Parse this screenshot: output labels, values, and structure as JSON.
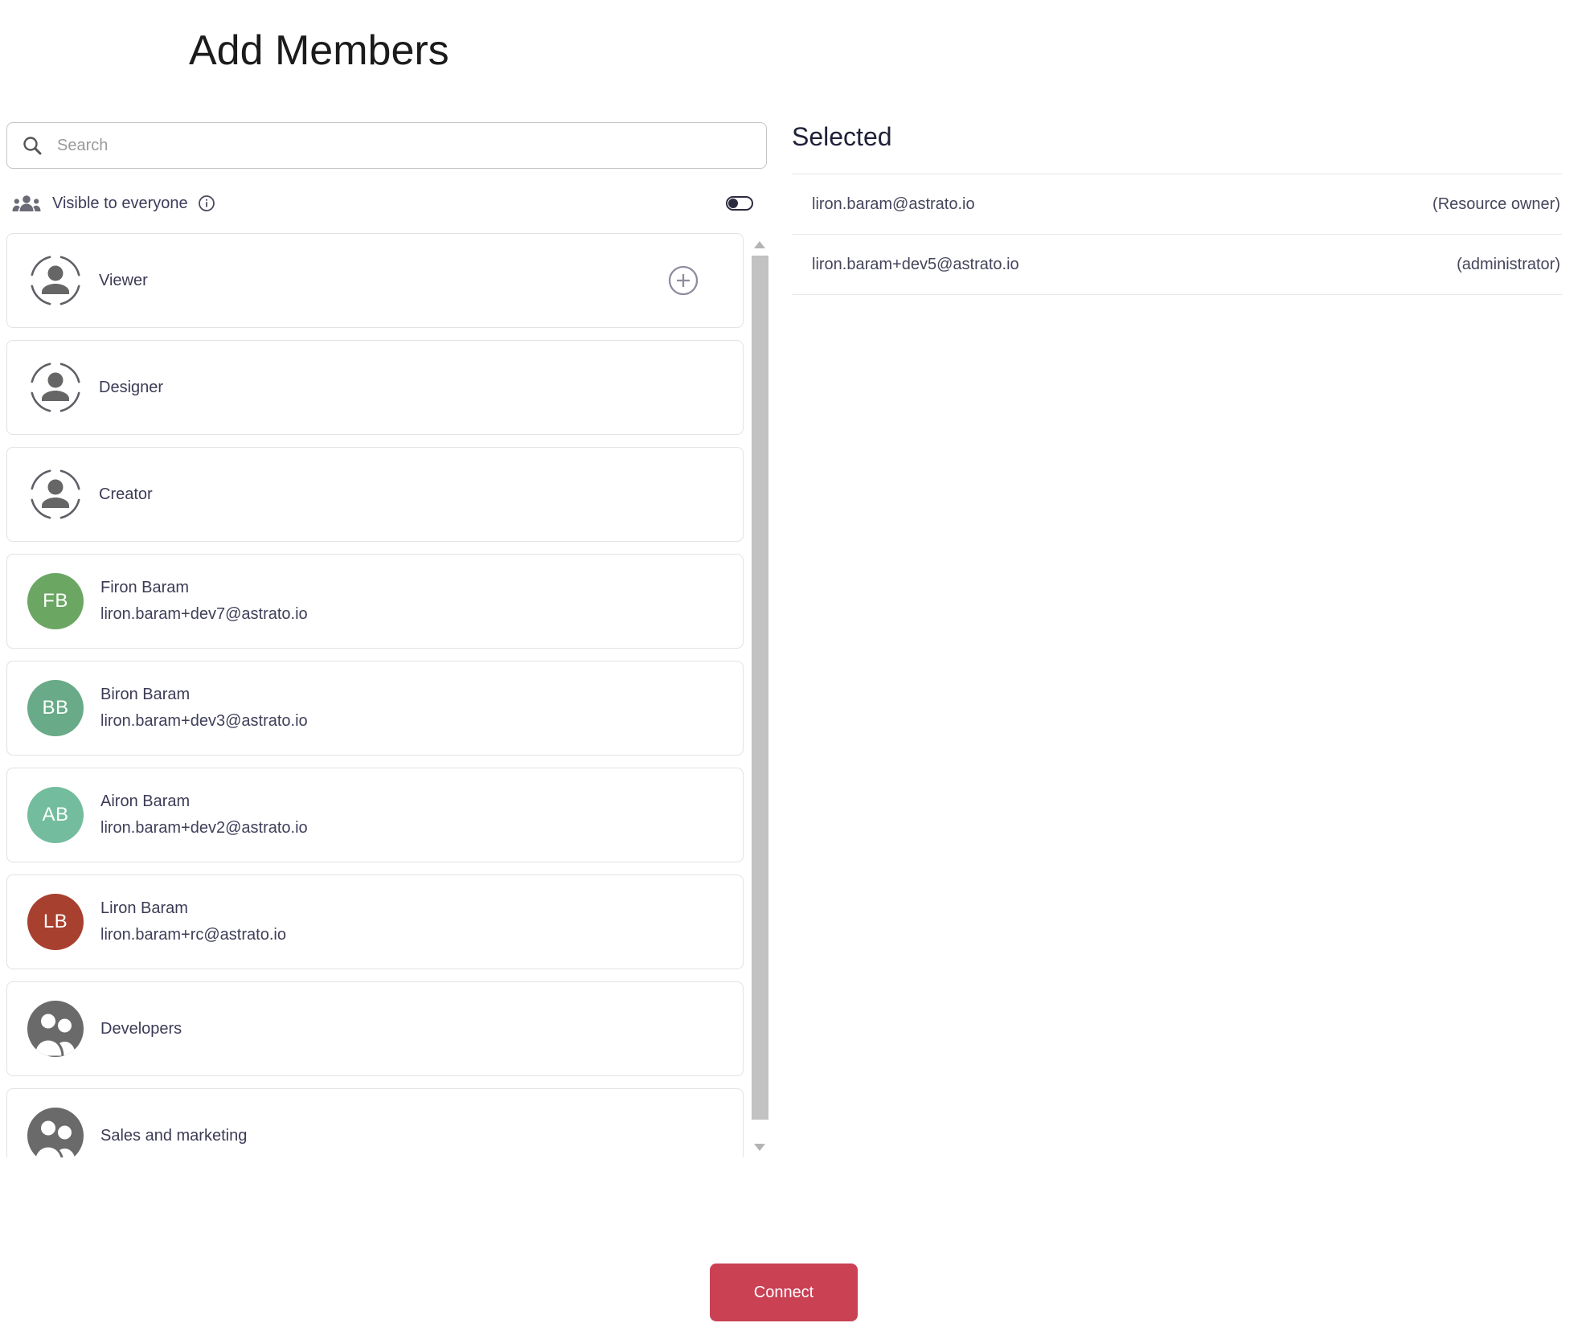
{
  "header": {
    "title": "Add Members"
  },
  "search": {
    "placeholder": "Search",
    "value": ""
  },
  "visibility": {
    "label": "Visible to everyone",
    "enabled": false
  },
  "list": {
    "items": [
      {
        "type": "role",
        "name": "Viewer",
        "action": "add"
      },
      {
        "type": "role",
        "name": "Designer"
      },
      {
        "type": "role",
        "name": "Creator"
      },
      {
        "type": "user",
        "name": "Firon Baram",
        "email": "liron.baram+dev7@astrato.io",
        "initials": "FB",
        "avatar_color": "#6BA763"
      },
      {
        "type": "user",
        "name": "Biron Baram",
        "email": "liron.baram+dev3@astrato.io",
        "initials": "BB",
        "avatar_color": "#69AA88"
      },
      {
        "type": "user",
        "name": "Airon Baram",
        "email": "liron.baram+dev2@astrato.io",
        "initials": "AB",
        "avatar_color": "#73BD9E"
      },
      {
        "type": "user",
        "name": "Liron Baram",
        "email": "liron.baram+rc@astrato.io",
        "initials": "LB",
        "avatar_color": "#A8402F"
      },
      {
        "type": "group",
        "name": "Developers"
      },
      {
        "type": "group",
        "name": "Sales and marketing"
      }
    ]
  },
  "selected": {
    "title": "Selected",
    "members": [
      {
        "email": "liron.baram@astrato.io",
        "role": "(Resource owner)"
      },
      {
        "email": "liron.baram+dev5@astrato.io",
        "role": "(administrator)"
      }
    ]
  },
  "footer": {
    "connect_label": "Connect"
  },
  "colors": {
    "connect_button": "#CA4154",
    "toggle": "#2B2B40",
    "avatar_firon": "#6BA763",
    "avatar_biron": "#69AA88",
    "avatar_airon": "#73BD9E",
    "avatar_liron": "#A8402F"
  }
}
